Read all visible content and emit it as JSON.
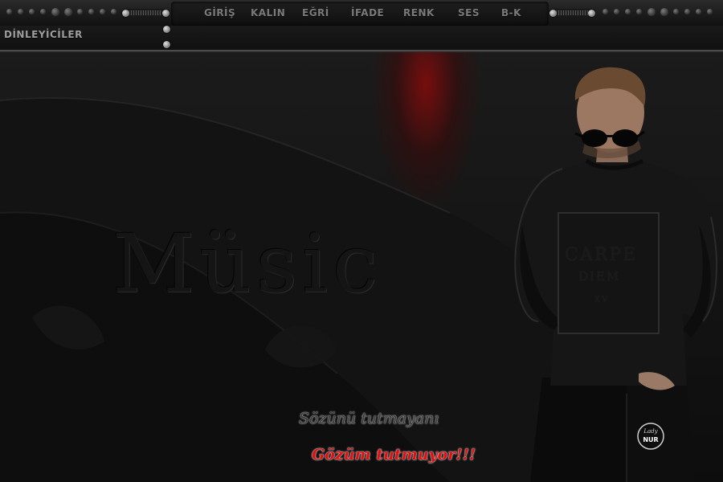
{
  "nav": {
    "items": [
      {
        "id": "giris",
        "label": "GİRİŞ"
      },
      {
        "id": "kalin",
        "label": "KALIN"
      },
      {
        "id": "egri",
        "label": "EĞRİ"
      },
      {
        "id": "ifade",
        "label": "İFADE"
      },
      {
        "id": "renk",
        "label": "RENK"
      },
      {
        "id": "ses",
        "label": "SES"
      },
      {
        "id": "bk",
        "label": "B-K"
      }
    ]
  },
  "sidebar": {
    "listeners_label": "DİNLEYİCİLER"
  },
  "background": {
    "music_text": "Müsic"
  },
  "shirt": {
    "line1": "CARPE",
    "line2": "DIEM",
    "line3": "XV"
  },
  "captions": {
    "line1": "Sözünü tutmayanı",
    "line2": "Gözüm tutmuyor!!!"
  },
  "logo": {
    "line1": "Lady",
    "line2": "NUR"
  },
  "colors": {
    "caption_highlight": "#e01010",
    "glow_red": "#960a0a",
    "nav_text": "#7a7a7a"
  },
  "icons": {
    "volume_slider_left": "slider-icon",
    "volume_slider_right": "slider-icon",
    "side_knobs": "knob-icon"
  }
}
